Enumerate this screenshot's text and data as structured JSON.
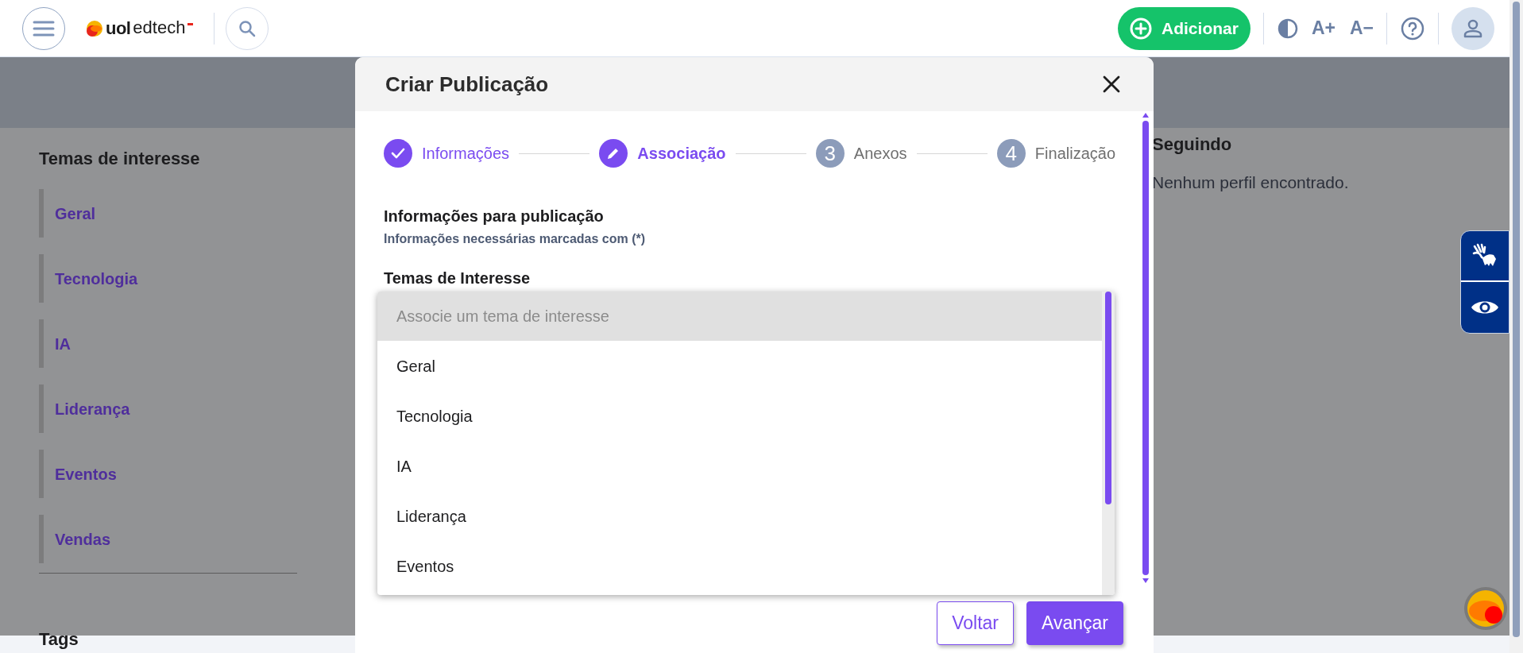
{
  "header": {
    "logo": {
      "brand": "uol",
      "product": "edtech"
    },
    "add_button": "Adicionar",
    "font_increase": "A+",
    "font_decrease": "A−"
  },
  "sidebar": {
    "title": "Temas de interesse",
    "items": [
      {
        "label": "Geral"
      },
      {
        "label": "Tecnologia"
      },
      {
        "label": "IA"
      },
      {
        "label": "Liderança"
      },
      {
        "label": "Eventos"
      },
      {
        "label": "Vendas"
      }
    ],
    "tags_title": "Tags"
  },
  "following": {
    "title": "Seguindo",
    "empty": "Nenhum perfil encontrado."
  },
  "modal": {
    "title": "Criar Publicação",
    "steps": [
      {
        "label": "Informações",
        "completed": true,
        "current": false
      },
      {
        "label": "Associação",
        "completed": false,
        "current": true
      },
      {
        "label": "Anexos",
        "completed": false,
        "current": false,
        "number": "3"
      },
      {
        "label": "Finalização",
        "completed": false,
        "current": false,
        "number": "4"
      }
    ],
    "section_title": "Informações para publicação",
    "section_subtitle": "Informações necessárias marcadas com (*)",
    "field_label": "Temas de Interesse",
    "dropdown": {
      "placeholder": "Associe um tema de interesse",
      "options": [
        "Geral",
        "Tecnologia",
        "IA",
        "Liderança",
        "Eventos"
      ]
    },
    "buttons": [
      {
        "label": "Voltar",
        "kind": "secondary"
      },
      {
        "label": "Avançar",
        "kind": "primary"
      }
    ]
  }
}
